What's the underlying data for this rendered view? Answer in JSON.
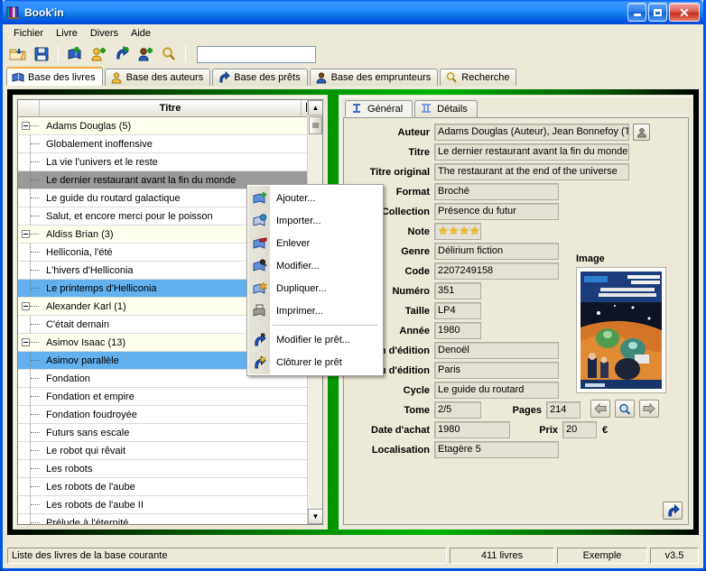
{
  "window": {
    "title": "Book'in",
    "icon": "books-icon",
    "controls": [
      {
        "name": "minimize-button",
        "label": "_"
      },
      {
        "name": "maximize-button",
        "label": "□"
      },
      {
        "name": "close-button",
        "label": "✕"
      }
    ]
  },
  "menubar": {
    "items": [
      {
        "name": "menu-fichier",
        "label": "Fichier"
      },
      {
        "name": "menu-livre",
        "label": "Livre"
      },
      {
        "name": "menu-divers",
        "label": "Divers"
      },
      {
        "name": "menu-aide",
        "label": "Aide"
      }
    ]
  },
  "toolbar": {
    "buttons": [
      {
        "name": "open-database-icon",
        "label": "Ouvrir"
      },
      {
        "name": "save-icon",
        "label": "Enregistrer"
      },
      {
        "name": "add-book-icon",
        "label": "Ajouter un livre"
      },
      {
        "name": "add-author-icon",
        "label": "Ajouter un auteur"
      },
      {
        "name": "add-loan-icon",
        "label": "Ajouter un prêt"
      },
      {
        "name": "add-borrower-icon",
        "label": "Ajouter un emprunteur"
      },
      {
        "name": "search-icon",
        "label": "Recherche"
      }
    ],
    "search_value": "",
    "search_placeholder": ""
  },
  "tabs": [
    {
      "name": "tab-base-des-livres",
      "label": "Base des livres",
      "icon": "book-icon",
      "active": true
    },
    {
      "name": "tab-base-des-auteurs",
      "label": "Base des auteurs",
      "icon": "person-yellow-icon",
      "active": false
    },
    {
      "name": "tab-base-des-prets",
      "label": "Base des prêts",
      "icon": "loan-arrow-icon",
      "active": false
    },
    {
      "name": "tab-base-des-emprunteurs",
      "label": "Base des emprunteurs",
      "icon": "person-blue-icon",
      "active": false
    },
    {
      "name": "tab-recherche",
      "label": "Recherche",
      "icon": "magnifier-icon",
      "active": false
    }
  ],
  "tree": {
    "column_header": "Titre",
    "column_button": "column-chooser-icon",
    "rows": [
      {
        "type": "group",
        "label": "Adams Douglas (5)",
        "state": "normal"
      },
      {
        "type": "leaf",
        "label": "Globalement inoffensive",
        "state": "normal"
      },
      {
        "type": "leaf",
        "label": "La vie l'univers et le reste",
        "state": "normal"
      },
      {
        "type": "leaf",
        "label": "Le dernier restaurant avant la fin du monde",
        "state": "selected-gray"
      },
      {
        "type": "leaf",
        "label": "Le guide du routard galactique",
        "state": "normal"
      },
      {
        "type": "leaf",
        "label": "Salut, et encore merci pour le poisson",
        "state": "normal"
      },
      {
        "type": "group",
        "label": "Aldiss Brian (3)",
        "state": "normal"
      },
      {
        "type": "leaf",
        "label": "Helliconia, l'été",
        "state": "normal"
      },
      {
        "type": "leaf",
        "label": "L'hivers d'Helliconia",
        "state": "normal"
      },
      {
        "type": "leaf",
        "label": "Le printemps d'Helliconia",
        "state": "selected-blue"
      },
      {
        "type": "group",
        "label": "Alexander Karl (1)",
        "state": "normal"
      },
      {
        "type": "leaf",
        "label": "C'était demain",
        "state": "normal"
      },
      {
        "type": "group",
        "label": "Asimov Isaac (13)",
        "state": "normal"
      },
      {
        "type": "leaf",
        "label": "Asimov parallèle",
        "state": "selected-blue"
      },
      {
        "type": "leaf",
        "label": "Fondation",
        "state": "normal"
      },
      {
        "type": "leaf",
        "label": "Fondation et empire",
        "state": "normal"
      },
      {
        "type": "leaf",
        "label": "Fondation foudroyée",
        "state": "normal"
      },
      {
        "type": "leaf",
        "label": "Futurs sans escale",
        "state": "normal"
      },
      {
        "type": "leaf",
        "label": "Le robot qui rêvait",
        "state": "normal"
      },
      {
        "type": "leaf",
        "label": "Les robots",
        "state": "normal"
      },
      {
        "type": "leaf",
        "label": "Les robots de l'aube",
        "state": "normal"
      },
      {
        "type": "leaf",
        "label": "Les robots de l'aube II",
        "state": "normal"
      },
      {
        "type": "leaf",
        "label": "Prélude à l'éternité",
        "state": "normal"
      }
    ],
    "scroll_up": "scroll-up-icon",
    "scroll_down": "scroll-down-icon"
  },
  "context_menu": {
    "items": [
      {
        "name": "ctx-ajouter",
        "label": "Ajouter...",
        "icon": "book-add-icon"
      },
      {
        "name": "ctx-importer",
        "label": "Importer...",
        "icon": "book-import-icon"
      },
      {
        "name": "ctx-enlever",
        "label": "Enlever",
        "icon": "book-remove-icon"
      },
      {
        "name": "ctx-modifier",
        "label": "Modifier...",
        "icon": "book-edit-icon"
      },
      {
        "name": "ctx-dupliquer",
        "label": "Dupliquer...",
        "icon": "book-duplicate-icon"
      },
      {
        "name": "ctx-imprimer",
        "label": "Imprimer...",
        "icon": "printer-icon"
      },
      {
        "name": "ctx-separator",
        "label": "",
        "icon": "separator"
      },
      {
        "name": "ctx-modifier-pret",
        "label": "Modifier le prêt...",
        "icon": "loan-edit-icon"
      },
      {
        "name": "ctx-cloturer-pret",
        "label": "Clôturer le prêt",
        "icon": "loan-close-icon"
      }
    ]
  },
  "detail": {
    "subtabs": [
      {
        "name": "subtab-general",
        "label": "Général",
        "icon": "tab-general-icon",
        "active": true
      },
      {
        "name": "subtab-details",
        "label": "Détails",
        "icon": "tab-details-icon",
        "active": false
      }
    ],
    "fields": {
      "auteur_label": "Auteur",
      "auteur_value": "Adams Douglas (Auteur), Jean Bonnefoy  (Tra",
      "titre_label": "Titre",
      "titre_value": "Le dernier restaurant avant la fin du monde",
      "titre_original_label": "Titre original",
      "titre_original_value": "The restaurant at the end of the universe",
      "format_label": "Format",
      "format_value": "Broché",
      "collection_label": "Collection",
      "collection_value": "Présence du futur",
      "note_label": "Note",
      "note_value": "★★★★",
      "note_stars": 4,
      "genre_label": "Genre",
      "genre_value": "Délirium fiction",
      "code_label": "Code",
      "code_value": "2207249158",
      "numero_label": "Numéro",
      "numero_value": "351",
      "taille_label": "Taille",
      "taille_value": "LP4",
      "annee_label": "Année",
      "annee_value": "1980",
      "maison_label": "Maison d'édition",
      "maison_value": "Denoël",
      "lieu_label": "Lieu d'édition",
      "lieu_value": "Paris",
      "cycle_label": "Cycle",
      "cycle_value": "Le guide du routard",
      "tome_label": "Tome",
      "tome_value": "2/5",
      "pages_label": "Pages",
      "pages_value": "214",
      "date_achat_label": "Date d'achat",
      "date_achat_value": "1980",
      "prix_label": "Prix",
      "prix_value": "20",
      "prix_currency": "€",
      "localisation_label": "Localisation",
      "localisation_value": "Etagère 5"
    },
    "image": {
      "label": "Image",
      "cover_title_line1": "Le dernier restaurant",
      "cover_title_line2": "avant la fin du monde",
      "cover_author": "DOUGLAS ADAMS",
      "cover_publisher": "DENOEL",
      "nav": [
        {
          "name": "image-prev-button",
          "icon": "arrow-left-icon"
        },
        {
          "name": "image-zoom-button",
          "icon": "magnifier-icon"
        },
        {
          "name": "image-next-button",
          "icon": "arrow-right-icon"
        }
      ]
    },
    "author_picker_icon": "person-icon",
    "submit_icon": "loan-arrow-icon"
  },
  "statusbar": {
    "message": "Liste des livres de la base courante",
    "count": "411 livres",
    "database": "Exemple",
    "version": "v3.5"
  },
  "colors": {
    "title_blue": "#0054e3",
    "panel_face": "#ece9d8",
    "splitter_green": "#00a000",
    "selection_blue": "#62b0ee",
    "selection_gray": "#9a9a9a",
    "group_row": "#fffff0",
    "accent_orange": "#f1a83c"
  }
}
